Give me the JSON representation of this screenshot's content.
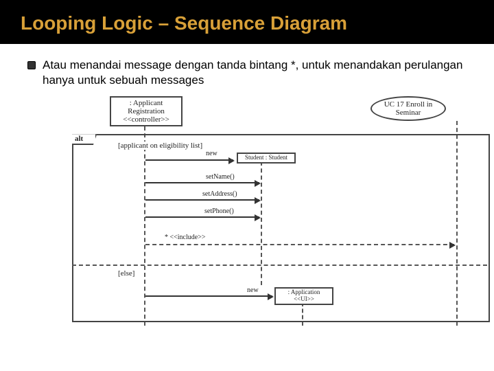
{
  "header": {
    "title": "Looping Logic – Sequence Diagram"
  },
  "bullet": {
    "text": "Atau menandai message dengan tanda bintang *, untuk menandakan perulangan hanya untuk sebuah messages"
  },
  "diagram": {
    "object1": ": Applicant Registration",
    "object1_st": "<<controller>>",
    "actor": "UC 17 Enroll in Seminar",
    "object2": "Student : Student",
    "object3": ": Application <<UI>>",
    "alt_label": "alt",
    "guard1": "[applicant on eligibility list]",
    "guard2": "[else]",
    "msg_new1": "new",
    "msg_setName": "setName()",
    "msg_setAddress": "setAddress()",
    "msg_setPhone": "setPhone()",
    "msg_include": "* <<include>>",
    "msg_new2": "new"
  }
}
